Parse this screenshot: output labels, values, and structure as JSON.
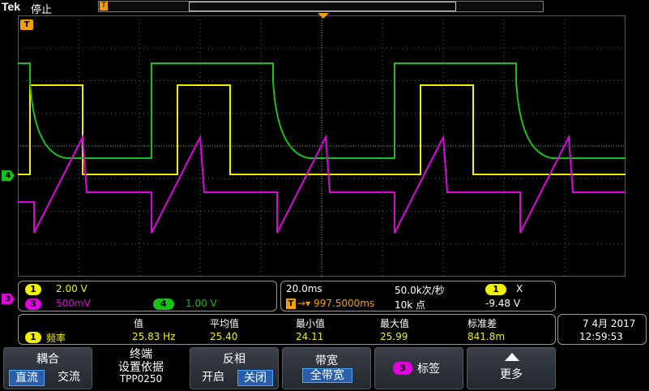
{
  "topbar": {
    "brand": "Tek",
    "run_state": "停止",
    "trigger_marker": "T"
  },
  "markers": {
    "trigger_level": "T",
    "ch4": "4",
    "ch3": "3"
  },
  "colors": {
    "ch1": "#f0f000",
    "ch3": "#e000e0",
    "ch4": "#18c018",
    "grid": "#5a5a5a",
    "trigger": "#f0a000"
  },
  "channels": {
    "ch1": {
      "num": "1",
      "scale": "2.00 V"
    },
    "ch3": {
      "num": "3",
      "scale": "500mV"
    },
    "ch4": {
      "num": "4",
      "scale": "1.00 V"
    }
  },
  "timebase": {
    "horizontal": "20.0ms",
    "sample_rate": "50.0k次/秒",
    "trigger_pos": "997.5000ms",
    "record_length": "10k 点",
    "trig_channel": "1",
    "trig_slope": "X",
    "trig_level": "-9.48 V"
  },
  "measurement": {
    "headers": [
      "值",
      "平均值",
      "最小值",
      "最大值",
      "标准差"
    ],
    "channel": "1",
    "name": "频率",
    "values": [
      "25.83 Hz",
      "25.40",
      "24.11",
      "25.99",
      "841.8m"
    ]
  },
  "datetime": {
    "date": "7 4月 2017",
    "time": "12:59:53"
  },
  "menu": {
    "coupling": {
      "title": "耦合",
      "opt1": "直流",
      "opt2": "交流"
    },
    "termination": {
      "line1": "终端",
      "line2": "设置依据",
      "line3": "TPP0250"
    },
    "invert": {
      "title": "反相",
      "opt1": "开启",
      "opt2": "关闭"
    },
    "bandwidth": {
      "title": "带宽",
      "value": "全带宽"
    },
    "label": {
      "num": "3",
      "title": "标签"
    },
    "more": {
      "title": "更多"
    }
  }
}
